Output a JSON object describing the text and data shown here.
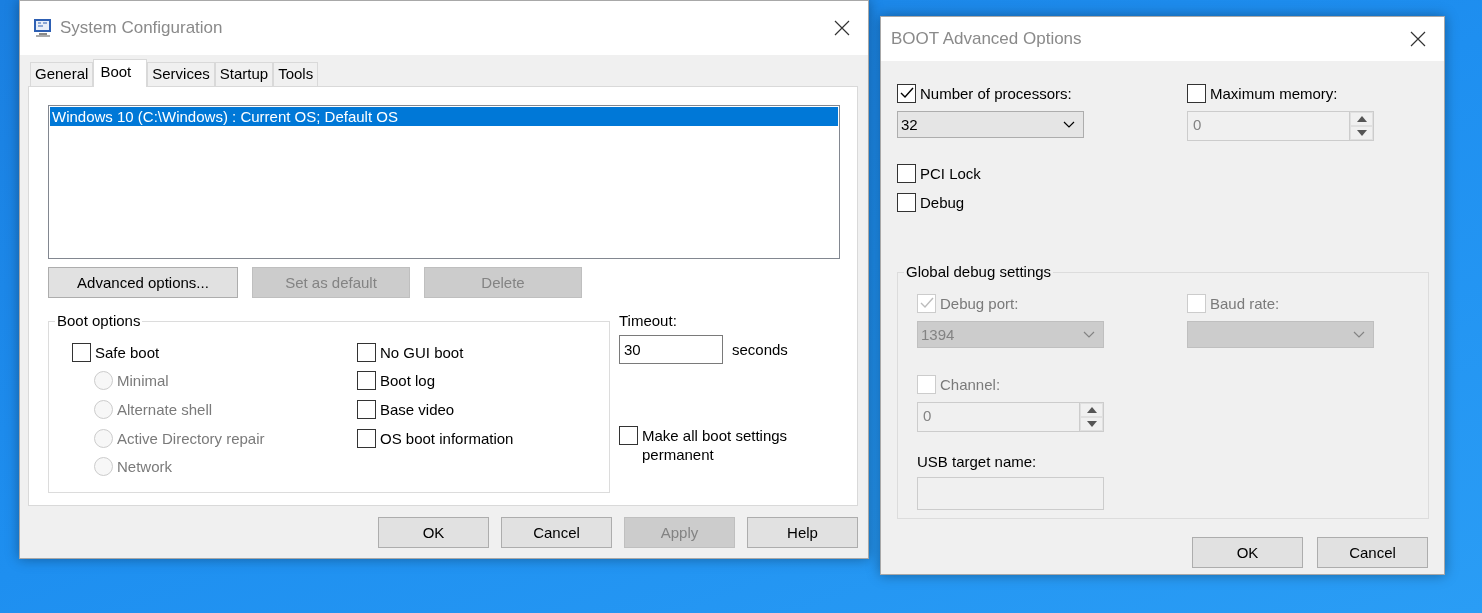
{
  "system_configuration": {
    "title": "System Configuration",
    "tabs": [
      {
        "label": "General",
        "selected": false
      },
      {
        "label": "Boot",
        "selected": true
      },
      {
        "label": "Services",
        "selected": false
      },
      {
        "label": "Startup",
        "selected": false
      },
      {
        "label": "Tools",
        "selected": false
      }
    ],
    "boot_entries": [
      {
        "label": "Windows 10 (C:\\Windows) : Current OS; Default OS",
        "selected": true
      }
    ],
    "entry_buttons": [
      {
        "label": "Advanced options...",
        "disabled": false
      },
      {
        "label": "Set as default",
        "disabled": true
      },
      {
        "label": "Delete",
        "disabled": true
      }
    ],
    "boot_options": {
      "title": "Boot options",
      "columns": [
        [
          {
            "kind": "checkbox",
            "label": "Safe boot",
            "checked": false,
            "disabled": false
          },
          {
            "kind": "radio",
            "label": "Minimal",
            "selected": false,
            "disabled": true
          },
          {
            "kind": "radio",
            "label": "Alternate shell",
            "selected": false,
            "disabled": true
          },
          {
            "kind": "radio",
            "label": "Active Directory repair",
            "selected": false,
            "disabled": true
          },
          {
            "kind": "radio",
            "label": "Network",
            "selected": false,
            "disabled": true
          }
        ],
        [
          {
            "kind": "checkbox",
            "label": "No GUI boot",
            "checked": false,
            "disabled": false
          },
          {
            "kind": "checkbox",
            "label": "Boot log",
            "checked": false,
            "disabled": false
          },
          {
            "kind": "checkbox",
            "label": "Base video",
            "checked": false,
            "disabled": false
          },
          {
            "kind": "checkbox",
            "label": "OS boot information",
            "checked": false,
            "disabled": false
          }
        ]
      ]
    },
    "timeout": {
      "label": "Timeout:",
      "value": "30",
      "unit": "seconds"
    },
    "make_permanent": {
      "label": "Make all boot settings permanent",
      "checked": false
    },
    "buttons": [
      {
        "label": "OK",
        "disabled": false
      },
      {
        "label": "Cancel",
        "disabled": false
      },
      {
        "label": "Apply",
        "disabled": true
      },
      {
        "label": "Help",
        "disabled": false
      }
    ]
  },
  "advanced_options": {
    "title": "BOOT Advanced Options",
    "settings": [
      {
        "kind": "dropdown",
        "label": "Number of processors:",
        "checked": true,
        "disabled": false,
        "control_disabled": false,
        "value": "32"
      },
      {
        "kind": "spinner",
        "label": "Maximum memory:",
        "checked": false,
        "disabled": false,
        "control_disabled": true,
        "value": "0"
      }
    ],
    "flags": [
      {
        "label": "PCI Lock",
        "checked": false
      },
      {
        "label": "Debug",
        "checked": false
      }
    ],
    "debug_group": {
      "title": "Global debug settings",
      "settings": [
        {
          "kind": "dropdown",
          "label": "Debug port:",
          "checked": true,
          "disabled": true,
          "control_disabled": true,
          "value": "1394"
        },
        {
          "kind": "dropdown",
          "label": "Baud rate:",
          "checked": false,
          "disabled": true,
          "control_disabled": true
        },
        {
          "kind": "spinner",
          "label": "Channel:",
          "checked": false,
          "disabled": true,
          "control_disabled": true,
          "value": "0"
        }
      ],
      "usb_target": {
        "label": "USB target name:",
        "disabled": true
      }
    },
    "buttons": [
      {
        "label": "OK"
      },
      {
        "label": "Cancel"
      }
    ]
  }
}
